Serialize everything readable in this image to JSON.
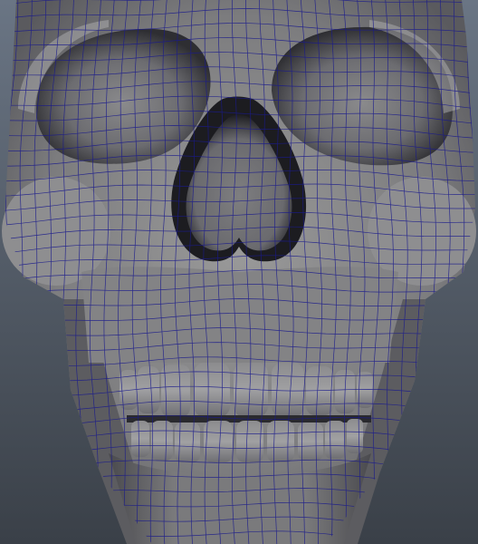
{
  "viewport": {
    "background_top": "#6a7584",
    "background_bottom": "#3a4048",
    "mesh_base": "#808080",
    "mesh_light": "#a9a9a9",
    "mesh_shadow": "#3e3e40",
    "wire_color": "#1a1a8c"
  },
  "model": {
    "name": "skull-model",
    "display_mode": "wireframe-on-shaded"
  }
}
